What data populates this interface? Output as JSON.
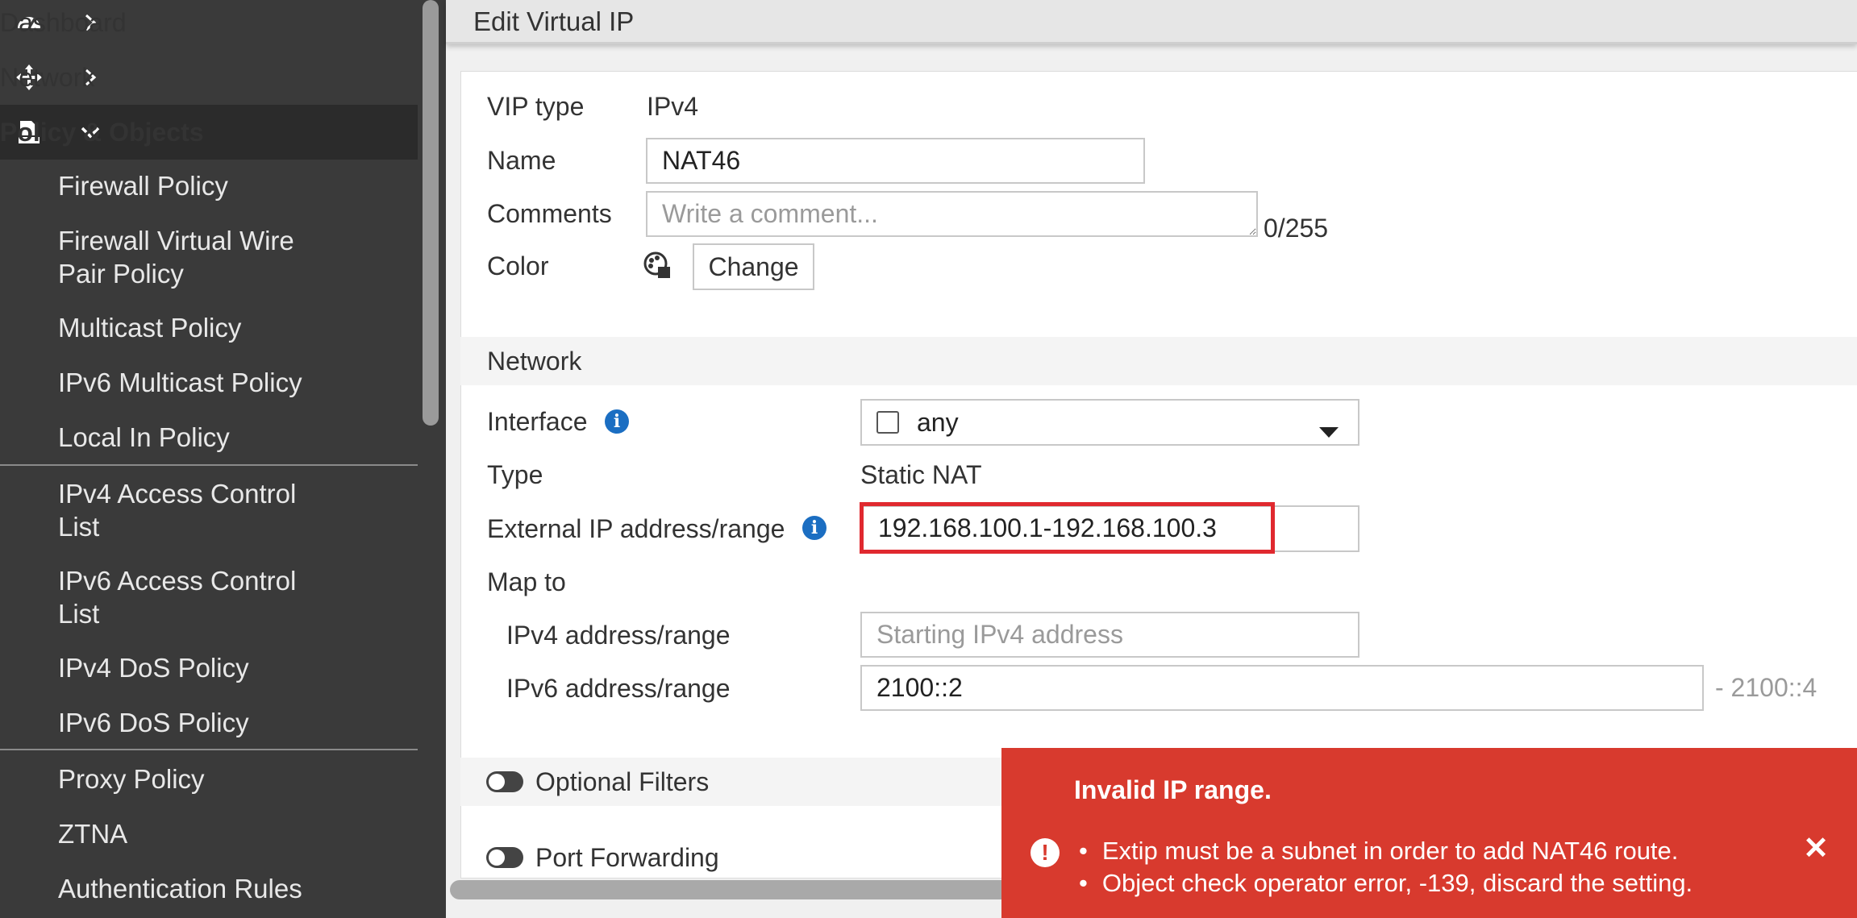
{
  "sidebar": {
    "nav_top": [
      {
        "label": "Dashboard"
      },
      {
        "label": "Network"
      },
      {
        "label": "Policy & Objects"
      }
    ],
    "sub_items": [
      "Firewall Policy",
      "Firewall Virtual Wire",
      "Pair Policy",
      "Multicast Policy",
      "IPv6 Multicast Policy",
      "Local In Policy",
      "IPv4 Access Control",
      "List",
      "IPv6 Access Control",
      "List",
      "IPv4 DoS Policy",
      "IPv6 DoS Policy",
      "Proxy Policy",
      "ZTNA",
      "Authentication Rules"
    ]
  },
  "page": {
    "title": "Edit Virtual IP"
  },
  "form": {
    "vip_type_label": "VIP type",
    "vip_type_value": "IPv4",
    "name_label": "Name",
    "name_value": "NAT46",
    "comments_label": "Comments",
    "comments_placeholder": "Write a comment...",
    "comments_counter": "0/255",
    "color_label": "Color",
    "change_button": "Change"
  },
  "network": {
    "section_title": "Network",
    "interface_label": "Interface",
    "interface_value": "any",
    "type_label": "Type",
    "type_value": "Static NAT",
    "extip_label": "External IP address/range",
    "extip_value": "192.168.100.1-192.168.100.3",
    "map_to_label": "Map to",
    "ipv4_range_label": "IPv4 address/range",
    "ipv4_placeholder": "Starting IPv4 address",
    "ipv6_range_label": "IPv6 address/range",
    "ipv6_value": "2100::2",
    "ipv6_range_end": "- 2100::4"
  },
  "options": {
    "optional_filters": "Optional Filters",
    "port_forwarding": "Port Forwarding"
  },
  "toast": {
    "title": "Invalid IP range.",
    "messages": [
      "Extip must be a subnet in order to add NAT46 route.",
      "Object check operator error, -139, discard the setting."
    ]
  },
  "colors": {
    "sidebar_bg": "#3a3a3a",
    "toast_bg": "#d83a2e",
    "info_icon": "#1b6ec2",
    "error_highlight": "#e0292f"
  }
}
